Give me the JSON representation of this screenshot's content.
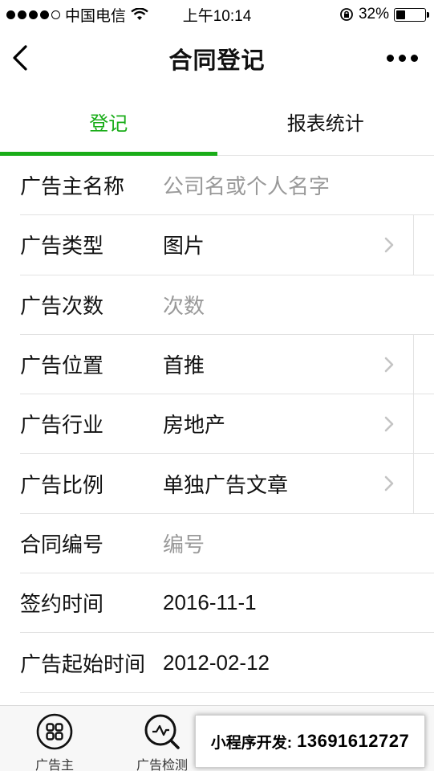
{
  "status_bar": {
    "carrier": "中国电信",
    "time": "上午10:14",
    "battery_percent": "32%",
    "battery_level": 0.32,
    "signal_dots_filled": 4,
    "signal_dots_total": 5,
    "icons": [
      "signal-dots-icon",
      "wifi-icon",
      "rotation-lock-icon",
      "battery-icon"
    ]
  },
  "nav": {
    "title": "合同登记",
    "back_icon": "chevron-left-icon",
    "more_icon": "more-dots-icon"
  },
  "tabs": [
    {
      "label": "登记",
      "active": true
    },
    {
      "label": "报表统计",
      "active": false
    }
  ],
  "form": {
    "rows": [
      {
        "label": "广告主名称",
        "value": "公司名或个人名字",
        "is_placeholder": true,
        "has_chevron": false
      },
      {
        "label": "广告类型",
        "value": "图片",
        "is_placeholder": false,
        "has_chevron": true
      },
      {
        "label": "广告次数",
        "value": "次数",
        "is_placeholder": true,
        "has_chevron": false
      },
      {
        "label": "广告位置",
        "value": "首推",
        "is_placeholder": false,
        "has_chevron": true
      },
      {
        "label": "广告行业",
        "value": "房地产",
        "is_placeholder": false,
        "has_chevron": true
      },
      {
        "label": "广告比例",
        "value": "单独广告文章",
        "is_placeholder": false,
        "has_chevron": true
      },
      {
        "label": "合同编号",
        "value": "编号",
        "is_placeholder": true,
        "has_chevron": false
      },
      {
        "label": "签约时间",
        "value": "2016-11-1",
        "is_placeholder": false,
        "has_chevron": false
      },
      {
        "label": "广告起始时间",
        "value": "2012-02-12",
        "is_placeholder": false,
        "has_chevron": false
      }
    ]
  },
  "tabbar": {
    "items": [
      {
        "label": "广告主",
        "icon": "grid-circle-icon"
      },
      {
        "label": "广告检测",
        "icon": "search-wave-icon"
      }
    ]
  },
  "promo": {
    "label": "小程序开发:",
    "phone": "13691612727"
  },
  "colors": {
    "accent": "#1aad19",
    "placeholder": "#999999",
    "divider": "#e2e2e2"
  }
}
